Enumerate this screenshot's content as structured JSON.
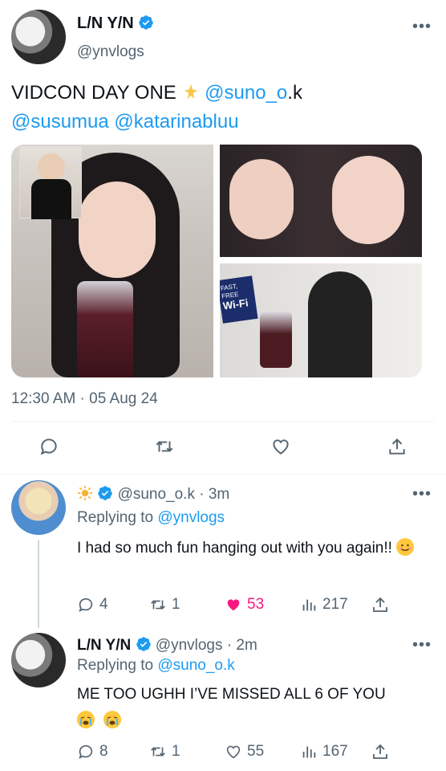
{
  "tweet": {
    "display_name": "L/N Y/N",
    "handle": "@ynvlogs",
    "text_main": "VIDCON DAY ONE",
    "mention1_prefix": "@suno_o",
    "mention1_suffix": ".k",
    "mention2": "@susumua",
    "mention3": "@katarinabluu",
    "timestamp": "12:30 AM · 05 Aug 24"
  },
  "reply1": {
    "handle": "@suno_o.k",
    "age": "3m",
    "replying_label": "Replying to",
    "replying_handle": "@ynvlogs",
    "text": "I had so much fun hanging out with you again!!",
    "replies": "4",
    "retweets": "1",
    "likes": "53",
    "views": "217"
  },
  "reply2": {
    "display_name": "L/N Y/N",
    "handle": "@ynvlogs",
    "age": "2m",
    "replying_label": "Replying to",
    "replying_handle": "@suno_o.k",
    "text": "ME TOO UGHH I’VE MISSED ALL 6 OF YOU",
    "replies": "8",
    "retweets": "1",
    "likes": "55",
    "views": "167"
  },
  "colors": {
    "link": "#1d9bf0",
    "muted": "#536471",
    "like_active": "#f91880",
    "divider": "#eff3f4"
  },
  "icons": [
    "more-icon",
    "verified-icon",
    "sparkle-icon",
    "reply-icon",
    "retweet-icon",
    "like-icon",
    "views-icon",
    "share-icon",
    "sun-emoji-icon",
    "smiling-emoji-icon",
    "crying-emoji-icon"
  ],
  "media": {
    "sign_line1": "FAST, FREE",
    "sign_line2": "Wi-Fi"
  }
}
